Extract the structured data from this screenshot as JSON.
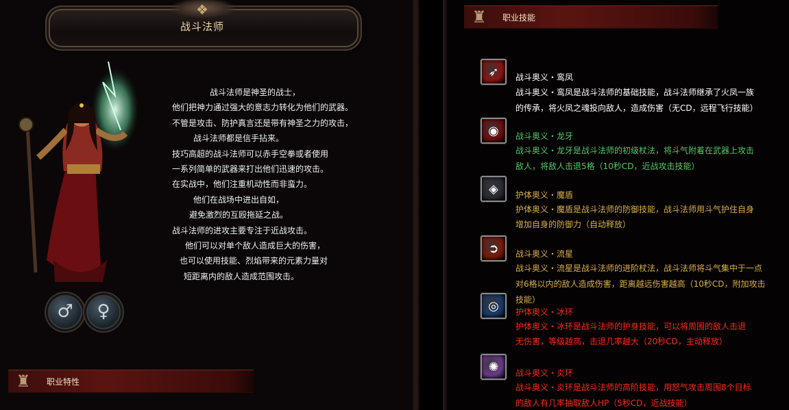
{
  "title": "战斗法师",
  "description_lines": [
    "战斗法师是神圣的战士，",
    "他们把神力通过强大的意志力转化为他们的武器。",
    "不管是攻击、防护真言还是带有神圣之力的攻击，",
    "战斗法师都是信手拈来。",
    "技巧高超的战斗法师可以赤手空拳或者使用",
    "一系列简单的武器来打出他们迅速的攻击。",
    "在实战中，他们注重机动性而非蛮力。",
    "他们在战场中进出自如，",
    "避免激烈的互殴拖延之战。",
    "战斗法师的进攻主要专注于近战攻击。",
    "他们可以对单个敌人造成巨大的伤害，",
    "也可以使用技能、烈焰带来的元素力量对",
    "短距离内的敌人造成范围攻击。"
  ],
  "gender": {
    "male_symbol": "♂",
    "female_symbol": "♀"
  },
  "sections": {
    "traits_label": "职业特性",
    "skills_label": "职业技能"
  },
  "skills": [
    {
      "name": "战斗奥义・鸾凤",
      "lines": [
        "战斗奥义・鸾凤是战斗法师的基础技能，战斗法师继承了火凤一族",
        "的传承，将火凤之魂投向敌人，造成伤害（无CD，远程飞行技能）"
      ],
      "color": "#ffffff",
      "icon": "phoenix-slash-icon",
      "icon_bg": "#8a1410"
    },
    {
      "name": "战斗奥义・龙牙",
      "lines": [
        "战斗奥义・龙牙是战斗法师的初级杖法，将斗气附着在武器上攻击",
        "敌人，将敌人击退5格（10秒CD，近战攻击技能）"
      ],
      "color": "#52c96a",
      "icon": "dragon-fang-icon",
      "icon_bg": "#6a0e0e"
    },
    {
      "name": "护体奥义・魔盾",
      "lines": [
        "护体奥义・魔盾是战斗法师的防御技能，战斗法师用斗气护住自身",
        "增加自身的防御力（自动释放）"
      ],
      "color": "#d8b048",
      "icon": "magic-shield-icon",
      "icon_bg": "#2a2a34"
    },
    {
      "name": "战斗奥义・流星",
      "lines": [
        "战斗奥义・流星是战斗法师的进阶杖法，战斗法师将斗气集中于一点",
        "对6格以内的敌人造成伤害，距离越远伤害越高（10秒CD，附加攻击",
        "技能）"
      ],
      "color": "#d8b048",
      "icon": "meteor-icon",
      "icon_bg": "#7a1a0a"
    },
    {
      "name": "护体奥义・冰环",
      "lines": [
        "护体奥义・冰环是战斗法师的护身技能，可以将周围的敌人击退",
        "无伤害，等级越高，击退几率越大（20秒CD，主动释放）"
      ],
      "color": "#ff2a1a",
      "icon": "ice-ring-icon",
      "icon_bg": "#1a3a6a"
    },
    {
      "name": "战斗奥义・炎环",
      "lines": [
        "战斗奥义・炎环是战斗法师的高阶技能，用怒气攻击周围8个目标",
        "的敌人有几率抽取敌人HP（5秒CD，近战技能）"
      ],
      "color": "#ff2a1a",
      "icon": "flame-ring-icon",
      "icon_bg": "#6a3a8a"
    }
  ]
}
